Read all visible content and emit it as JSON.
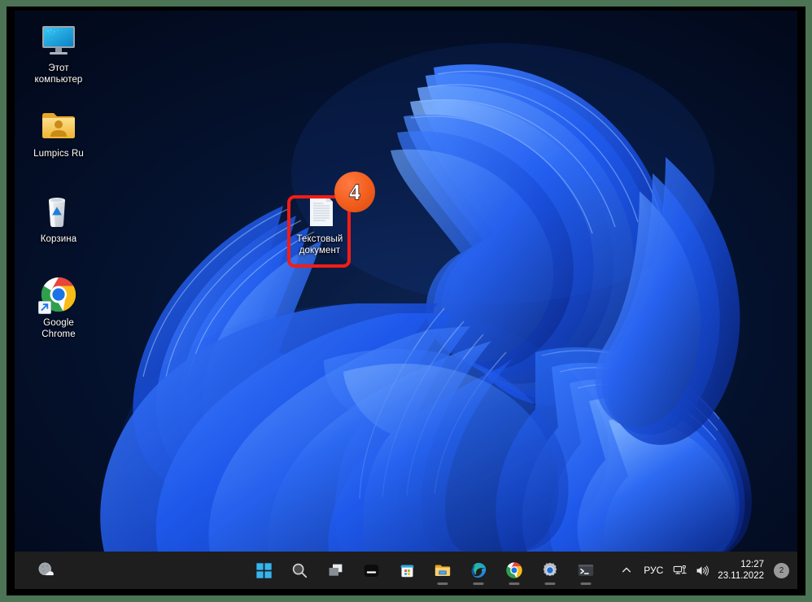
{
  "os": {
    "name": "Windows 11 Desktop",
    "wallpaper": "windows-11-bloom"
  },
  "colors": {
    "frame_green": "#4c7354",
    "bezel_black": "#000000",
    "desktop_dark": "#030b1c",
    "bloom_blue": "#1a5cf0",
    "taskbar": "#1e1e1e",
    "annotation_red": "#f41c14",
    "annotation_orange": "#f4601f"
  },
  "desktop": {
    "icons": [
      {
        "id": "this-pc",
        "label": "Этот\nкомпьютер",
        "label_line1": "Этот",
        "label_line2": "компьютер",
        "icon": "monitor-icon"
      },
      {
        "id": "lumpics",
        "label": "Lumpics Ru",
        "label_line1": "Lumpics Ru",
        "label_line2": "",
        "icon": "user-folder-icon"
      },
      {
        "id": "recycle",
        "label": "Корзина",
        "label_line1": "Корзина",
        "label_line2": "",
        "icon": "recycle-bin-icon"
      },
      {
        "id": "chrome",
        "label": "Google\nChrome",
        "label_line1": "Google",
        "label_line2": "Chrome",
        "icon": "google-chrome-icon"
      },
      {
        "id": "text-doc",
        "label": "Текстовый\nдокумент",
        "label_line1": "Текстовый",
        "label_line2": "документ",
        "icon": "text-document-icon"
      }
    ]
  },
  "annotation": {
    "step_number": "4",
    "target": "Текстовый документ",
    "rect_color": "#f41c14",
    "badge_color": "#f4601f"
  },
  "taskbar": {
    "weather": {
      "name": "weather-widget",
      "icon": "moon-cloud-icon",
      "label": ""
    },
    "buttons": [
      {
        "id": "start",
        "name": "start-button",
        "icon": "windows-logo-icon",
        "running": false
      },
      {
        "id": "search",
        "name": "search-button",
        "icon": "search-icon",
        "running": false
      },
      {
        "id": "taskview",
        "name": "task-view-button",
        "icon": "task-view-icon",
        "running": false
      },
      {
        "id": "widgets",
        "name": "widgets-button",
        "icon": "widgets-icon",
        "running": false
      },
      {
        "id": "store",
        "name": "microsoft-store-button",
        "icon": "microsoft-store-icon",
        "running": false
      },
      {
        "id": "explorer",
        "name": "file-explorer-button",
        "icon": "file-explorer-icon",
        "running": true
      },
      {
        "id": "edge",
        "name": "microsoft-edge-button",
        "icon": "microsoft-edge-icon",
        "running": true
      },
      {
        "id": "chrome",
        "name": "google-chrome-button",
        "icon": "google-chrome-icon",
        "running": true
      },
      {
        "id": "settings",
        "name": "settings-button",
        "icon": "gear-icon",
        "running": true
      },
      {
        "id": "terminal",
        "name": "terminal-button",
        "icon": "terminal-icon",
        "running": true
      }
    ],
    "tray": {
      "chevron": "chevron-up-icon",
      "language": "РУС",
      "network": "network-icon",
      "volume": "volume-icon",
      "time": "12:27",
      "date": "23.11.2022",
      "notification_count": "2"
    }
  }
}
